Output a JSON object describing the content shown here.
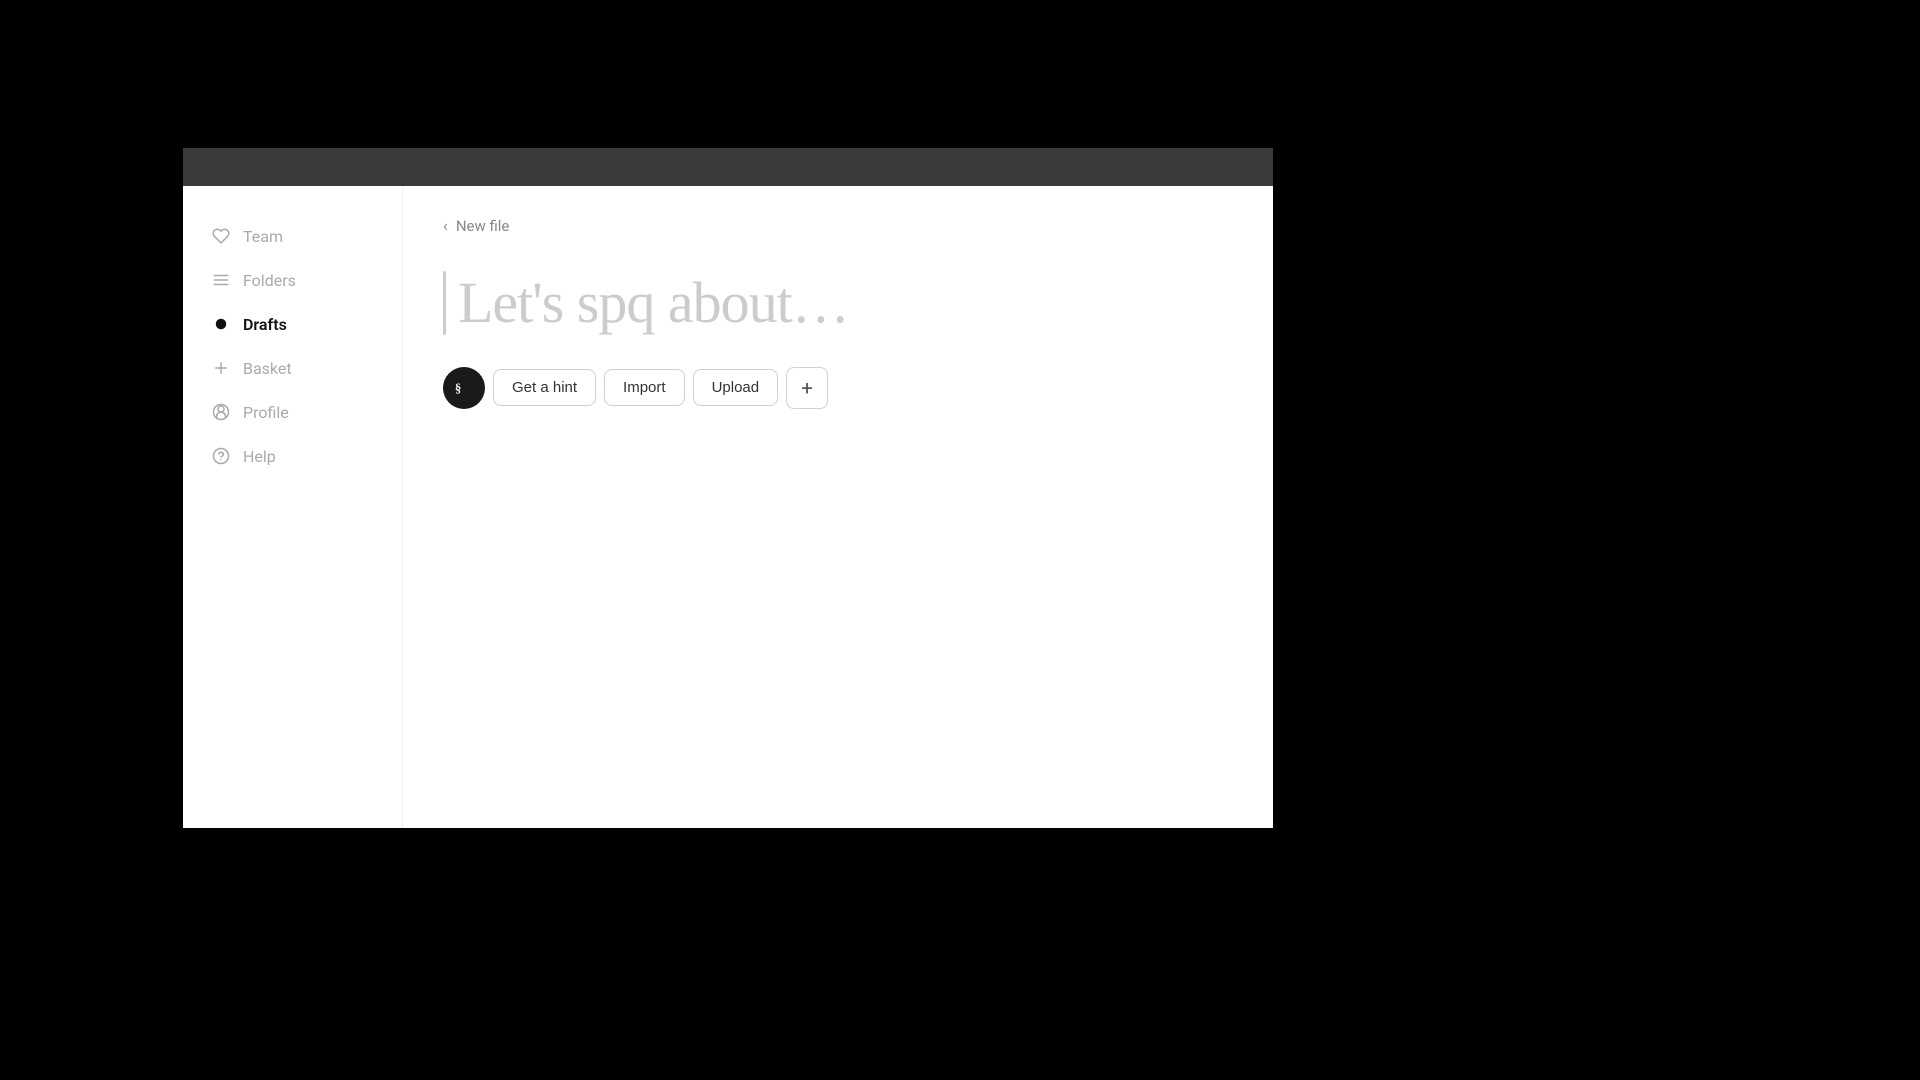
{
  "sidebar": {
    "items": [
      {
        "id": "team",
        "label": "Team",
        "active": false
      },
      {
        "id": "folders",
        "label": "Folders",
        "active": false
      },
      {
        "id": "drafts",
        "label": "Drafts",
        "active": true
      },
      {
        "id": "basket",
        "label": "Basket",
        "active": false
      },
      {
        "id": "profile",
        "label": "Profile",
        "active": false
      },
      {
        "id": "help",
        "label": "Help",
        "active": false
      }
    ]
  },
  "header": {
    "back_label": "New file"
  },
  "editor": {
    "placeholder": "Let's spq about…"
  },
  "toolbar": {
    "hint_label": "Get a hint",
    "import_label": "Import",
    "upload_label": "Upload",
    "plus_label": "+"
  },
  "colors": {
    "topbar": "#3a3a3a",
    "sidebar_active": "#111",
    "sidebar_inactive": "#aaa",
    "placeholder": "#ccc",
    "border": "#d0d0d0",
    "logo_bg": "#1a1a1a"
  }
}
